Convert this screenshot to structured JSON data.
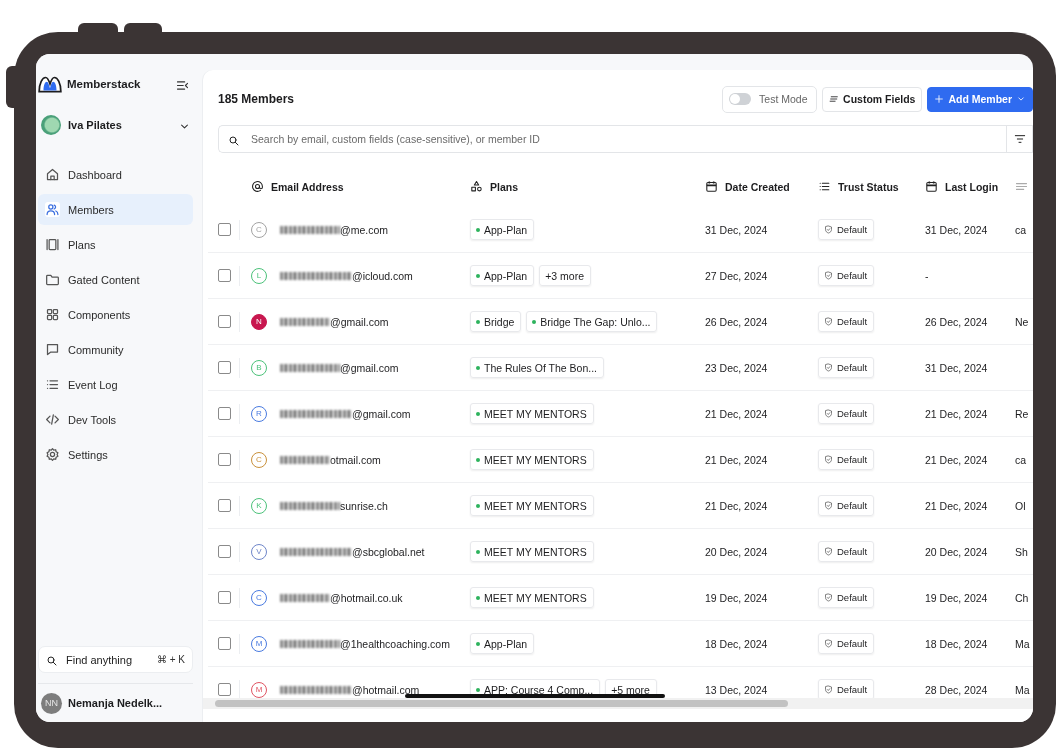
{
  "sidebar": {
    "brand": "Memberstack",
    "workspace": {
      "name": "Iva Pilates"
    },
    "nav": [
      {
        "label": "Dashboard",
        "selected": false
      },
      {
        "label": "Members",
        "selected": true
      },
      {
        "label": "Plans",
        "selected": false
      },
      {
        "label": "Gated Content",
        "selected": false
      },
      {
        "label": "Components",
        "selected": false
      },
      {
        "label": "Community",
        "selected": false
      },
      {
        "label": "Event Log",
        "selected": false
      },
      {
        "label": "Dev Tools",
        "selected": false
      },
      {
        "label": "Settings",
        "selected": false
      }
    ],
    "find": {
      "placeholder": "Find anything",
      "shortcut": "⌘ + K"
    },
    "user": {
      "initials": "NN",
      "name": "Nemanja Nedelk..."
    }
  },
  "main": {
    "title": "185 Members",
    "test_mode": {
      "label": "Test Mode",
      "on": false
    },
    "custom_fields": "Custom Fields",
    "add_member": "Add Member",
    "search": {
      "placeholder": "Search by email, custom fields (case-sensitive), or member ID"
    },
    "table": {
      "columns": [
        {
          "label": "Email Address"
        },
        {
          "label": "Plans"
        },
        {
          "label": "Date Created"
        },
        {
          "label": "Trust Status"
        },
        {
          "label": "Last Login"
        },
        {}
      ],
      "rows": [
        {
          "checked": false,
          "avatar": {
            "letter": "C",
            "color": "#a3a3a3",
            "filled": false
          },
          "email": "@me.com",
          "plans": [
            {
              "kind": "plan",
              "label": "App-Plan"
            }
          ],
          "date_created": "31 Dec, 2024",
          "trust_status": "Default",
          "last_login": "31 Dec, 2024",
          "column_6": "ca"
        },
        {
          "checked": false,
          "avatar": {
            "letter": "L",
            "color": "#4cc27a",
            "filled": false
          },
          "email": "@icloud.com",
          "plans": [
            {
              "kind": "plan",
              "label": "App-Plan"
            },
            {
              "kind": "more",
              "label": "+3 more"
            }
          ],
          "date_created": "27 Dec, 2024",
          "trust_status": "Default",
          "last_login": "-"
        },
        {
          "checked": false,
          "avatar": {
            "letter": "N",
            "color": "#c8174f",
            "filled": true
          },
          "email": "@gmail.com",
          "plans": [
            {
              "kind": "plan",
              "label": "Bridge"
            },
            {
              "kind": "plan",
              "label": "Bridge The Gap: Unlo..."
            }
          ],
          "date_created": "26 Dec, 2024",
          "trust_status": "Default",
          "last_login": "26 Dec, 2024",
          "column_6": "Ne"
        },
        {
          "checked": false,
          "avatar": {
            "letter": "B",
            "color": "#4cc27a",
            "filled": false
          },
          "email": "@gmail.com",
          "plans": [
            {
              "kind": "plan",
              "label": "The Rules Of The Bon..."
            }
          ],
          "date_created": "23 Dec, 2024",
          "trust_status": "Default",
          "last_login": "31 Dec, 2024"
        },
        {
          "checked": false,
          "avatar": {
            "letter": "R",
            "color": "#4a7be0",
            "filled": false
          },
          "email": "@gmail.com",
          "plans": [
            {
              "kind": "plan",
              "label": "MEET MY MENTORS"
            }
          ],
          "date_created": "21 Dec, 2024",
          "trust_status": "Default",
          "last_login": "21 Dec, 2024",
          "column_6": "Re"
        },
        {
          "checked": false,
          "avatar": {
            "letter": "C",
            "color": "#c9913c",
            "filled": false
          },
          "email": "otmail.com",
          "plans": [
            {
              "kind": "plan",
              "label": "MEET MY MENTORS"
            }
          ],
          "date_created": "21 Dec, 2024",
          "trust_status": "Default",
          "last_login": "21 Dec, 2024",
          "column_6": "ca"
        },
        {
          "checked": false,
          "avatar": {
            "letter": "K",
            "color": "#4cc27a",
            "filled": false
          },
          "email": "sunrise.ch",
          "plans": [
            {
              "kind": "plan",
              "label": "MEET MY MENTORS"
            }
          ],
          "date_created": "21 Dec, 2024",
          "trust_status": "Default",
          "last_login": "21 Dec, 2024",
          "column_6": "Ol"
        },
        {
          "checked": false,
          "avatar": {
            "letter": "V",
            "color": "#6f86c9",
            "filled": false
          },
          "email": "@sbcglobal.net",
          "plans": [
            {
              "kind": "plan",
              "label": "MEET MY MENTORS"
            }
          ],
          "date_created": "20 Dec, 2024",
          "trust_status": "Default",
          "last_login": "20 Dec, 2024",
          "column_6": "Sh"
        },
        {
          "checked": false,
          "avatar": {
            "letter": "C",
            "color": "#4a7be0",
            "filled": false
          },
          "email": "@hotmail.co.uk",
          "plans": [
            {
              "kind": "plan",
              "label": "MEET MY MENTORS"
            }
          ],
          "date_created": "19 Dec, 2024",
          "trust_status": "Default",
          "last_login": "19 Dec, 2024",
          "column_6": "Ch"
        },
        {
          "checked": false,
          "avatar": {
            "letter": "M",
            "color": "#4a7be0",
            "filled": false
          },
          "email": "@1healthcoaching.com",
          "plans": [
            {
              "kind": "plan",
              "label": "App-Plan"
            }
          ],
          "date_created": "18 Dec, 2024",
          "trust_status": "Default",
          "last_login": "18 Dec, 2024",
          "column_6": "Ma"
        },
        {
          "checked": false,
          "avatar": {
            "letter": "M",
            "color": "#e05563",
            "filled": false
          },
          "email": "@hotmail.com",
          "plans": [
            {
              "kind": "plan",
              "label": "APP: Course 4 Comp..."
            },
            {
              "kind": "more",
              "label": "+5 more"
            }
          ],
          "date_created": "13 Dec, 2024",
          "trust_status": "Default",
          "last_login": "28 Dec, 2024",
          "column_6": "Ma"
        }
      ]
    }
  }
}
